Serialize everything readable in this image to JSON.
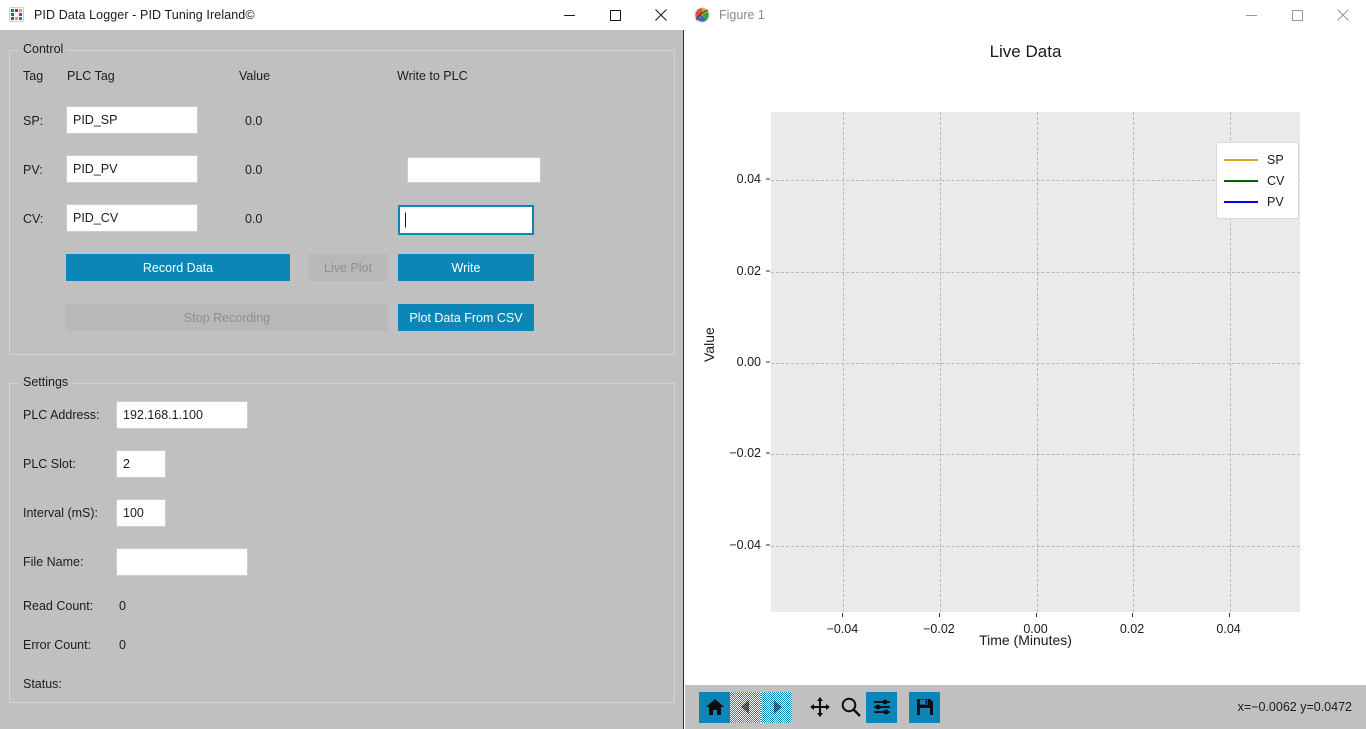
{
  "pid_window": {
    "title": "PID Data Logger - PID Tuning Ireland©",
    "app_icon": "dot-grid-icon",
    "window_controls": {
      "minimize": "minimize-icon",
      "maximize": "maximize-icon",
      "close": "close-icon"
    },
    "control_group": {
      "legend": "Control",
      "columns": {
        "tag": "Tag",
        "plc_tag": "PLC Tag",
        "value": "Value",
        "write": "Write to PLC"
      },
      "rows": [
        {
          "label": "SP:",
          "plc_tag": "PID_SP",
          "value": "0.0",
          "write_value": "",
          "write_focused": false
        },
        {
          "label": "PV:",
          "plc_tag": "PID_PV",
          "value": "0.0",
          "write_value": "",
          "write_focused": false
        },
        {
          "label": "CV:",
          "plc_tag": "PID_CV",
          "value": "0.0",
          "write_value": "",
          "write_focused": true
        }
      ],
      "buttons": {
        "record_data": "Record Data",
        "live_plot": "Live Plot",
        "write": "Write",
        "stop_recording": "Stop Recording",
        "plot_from_csv": "Plot Data From CSV"
      }
    },
    "settings_group": {
      "legend": "Settings",
      "fields": [
        {
          "label": "PLC Address:",
          "value": "192.168.1.100"
        },
        {
          "label": "PLC Slot:",
          "value": "2"
        },
        {
          "label": "Interval (mS):",
          "value": "100"
        },
        {
          "label": "File Name:",
          "value": ""
        }
      ],
      "readouts": [
        {
          "label": "Read Count:",
          "value": "0"
        },
        {
          "label": "Error Count:",
          "value": "0"
        },
        {
          "label": "Status:",
          "value": ""
        }
      ]
    },
    "colors": {
      "accent": "#0b86b6",
      "disabled": "#b8b8b8",
      "window_bg": "#c0c0c0"
    }
  },
  "figure_window": {
    "title": "Figure 1",
    "icon": "matplotlib-icon",
    "window_controls": {
      "minimize": "minimize-icon",
      "maximize": "maximize-icon",
      "close": "close-icon"
    },
    "toolbar": {
      "buttons": [
        {
          "name": "home-icon",
          "enabled": true
        },
        {
          "name": "back-arrow-icon",
          "enabled": false
        },
        {
          "name": "forward-arrow-icon",
          "enabled": false
        },
        {
          "name": "pan-move-icon",
          "enabled": true
        },
        {
          "name": "zoom-magnifier-icon",
          "enabled": true
        },
        {
          "name": "configure-subplots-icon",
          "enabled": true
        },
        {
          "name": "save-disk-icon",
          "enabled": true
        }
      ]
    },
    "coordinates": "x=−0.0062 y=0.0472"
  },
  "chart_data": {
    "type": "line",
    "title": "Live Data",
    "xlabel": "Time (Minutes)",
    "ylabel": "Value",
    "xlim": [
      -0.055,
      0.055
    ],
    "ylim": [
      -0.055,
      0.055
    ],
    "xticks": [
      "−0.04",
      "−0.02",
      "0.00",
      "0.02",
      "0.04"
    ],
    "xtick_values": [
      -0.04,
      -0.02,
      0.0,
      0.02,
      0.04
    ],
    "yticks": [
      "0.04",
      "0.02",
      "0.00",
      "−0.02",
      "−0.04"
    ],
    "ytick_values": [
      0.04,
      0.02,
      0.0,
      -0.02,
      -0.04
    ],
    "grid": true,
    "legend_position": "upper right",
    "axes_facecolor": "#eaeaea",
    "series": [
      {
        "name": "SP",
        "color": "#daa520",
        "values": [],
        "x": []
      },
      {
        "name": "CV",
        "color": "#006400",
        "values": [],
        "x": []
      },
      {
        "name": "PV",
        "color": "#0000ff",
        "values": [],
        "x": []
      }
    ]
  }
}
